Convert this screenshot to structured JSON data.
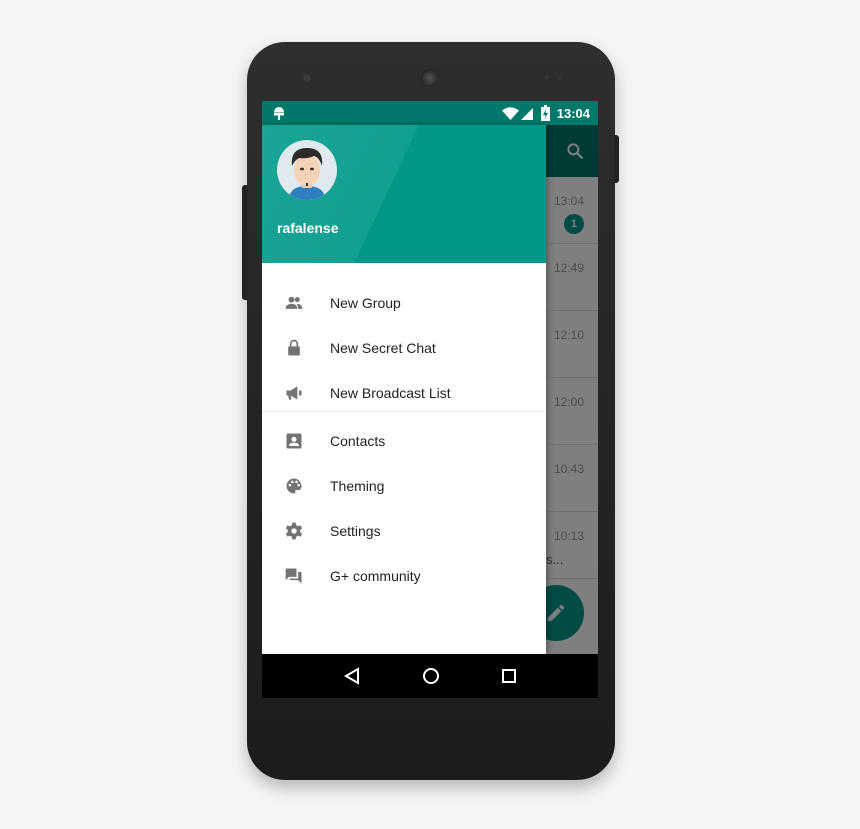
{
  "status_bar": {
    "time": "13:04",
    "icons": [
      "android-icon",
      "wifi-icon",
      "signal-icon",
      "battery-charging-icon"
    ]
  },
  "drawer": {
    "username": "rafalense",
    "accent": "#009688",
    "groups": [
      [
        {
          "label": "New Group",
          "icon": "group-icon"
        },
        {
          "label": "New Secret Chat",
          "icon": "lock-icon"
        },
        {
          "label": "New Broadcast List",
          "icon": "megaphone-icon"
        }
      ],
      [
        {
          "label": "Contacts",
          "icon": "contacts-icon"
        },
        {
          "label": "Theming",
          "icon": "palette-icon"
        },
        {
          "label": "Settings",
          "icon": "gear-icon"
        },
        {
          "label": "G+ community",
          "icon": "forum-icon"
        }
      ]
    ]
  },
  "chat_list": {
    "rows": [
      {
        "time": "13:04",
        "unread": "1"
      },
      {
        "time": "12:49"
      },
      {
        "time": "12:10"
      },
      {
        "time": "12:00"
      },
      {
        "time": "10:43"
      },
      {
        "time": "10:13",
        "snippet": "s..."
      }
    ]
  },
  "nav": {
    "buttons": [
      "back-icon",
      "home-icon",
      "recents-icon"
    ]
  }
}
